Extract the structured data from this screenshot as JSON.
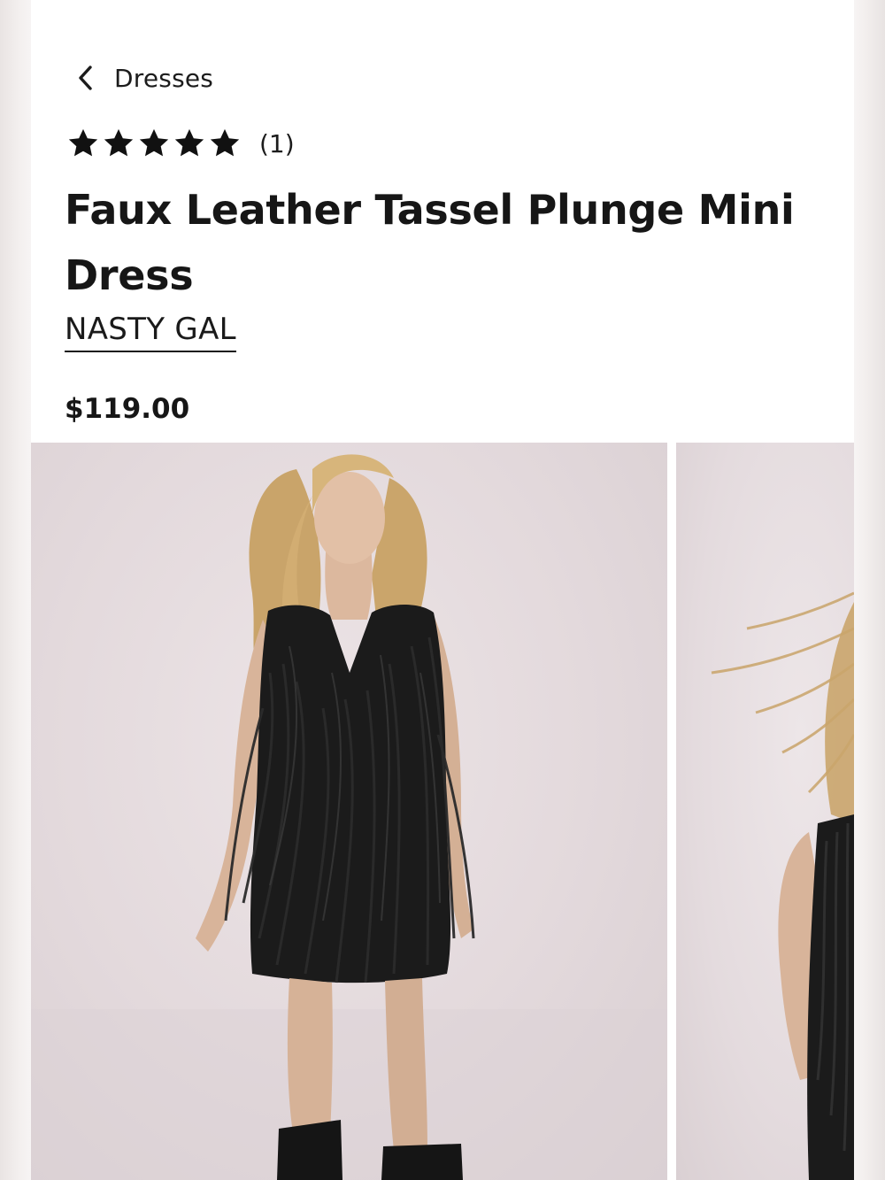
{
  "breadcrumb": {
    "label": "Dresses",
    "icon": "chevron-left-icon"
  },
  "rating": {
    "stars": 5,
    "max_stars": 5,
    "count_text": "(1)",
    "icon": "star-icon"
  },
  "product": {
    "title": "Faux Leather Tassel Plunge Mini Dress",
    "brand": "NASTY GAL",
    "price": "$119.00"
  },
  "gallery": {
    "images": [
      {
        "name": "product-image-front"
      },
      {
        "name": "product-image-detail"
      }
    ]
  },
  "colors": {
    "text": "#1a1a1a",
    "panel_background": "#ffffff",
    "photo_background": "#e6dde0",
    "dress": "#1b1b1b"
  }
}
